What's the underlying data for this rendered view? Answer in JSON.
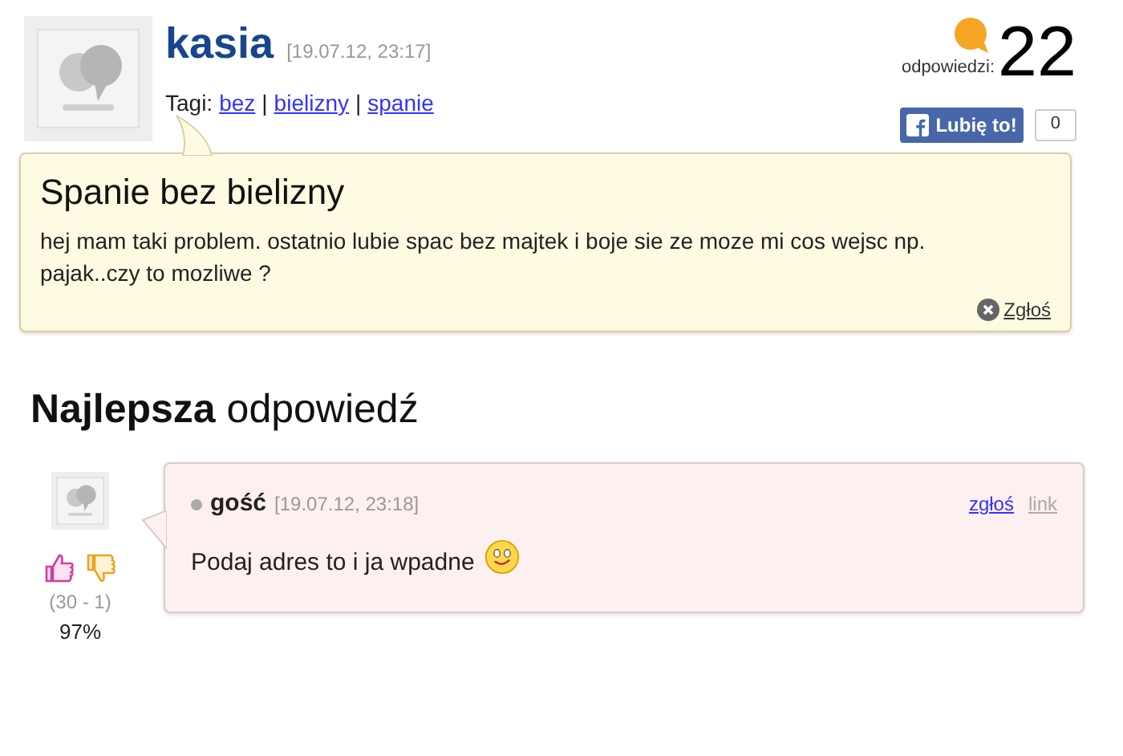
{
  "question": {
    "author": "kasia",
    "date": "[19.07.12, 23:17]",
    "tags_label": "Tagi:",
    "tags": [
      "bez",
      "bielizny",
      "spanie"
    ],
    "tag_separator": "|",
    "answers_label": "odpowiedzi:",
    "answers_count": "22",
    "like_button": "Lubię to!",
    "like_count": "0",
    "title": "Spanie bez bielizny",
    "body": "hej mam taki problem. ostatnio lubie spac bez majtek i boje sie ze moze mi cos wejsc np. pajak..czy to mozliwe ?",
    "report": "Zgłoś"
  },
  "best_answer": {
    "heading_bold": "Najlepsza",
    "heading_rest": "odpowiedź",
    "author": "gość",
    "date": "[19.07.12, 23:18]",
    "report": "zgłoś",
    "link": "link",
    "body": "Podaj adres to i ja wpadne",
    "votes": "(30 - 1)",
    "percent": "97%"
  }
}
